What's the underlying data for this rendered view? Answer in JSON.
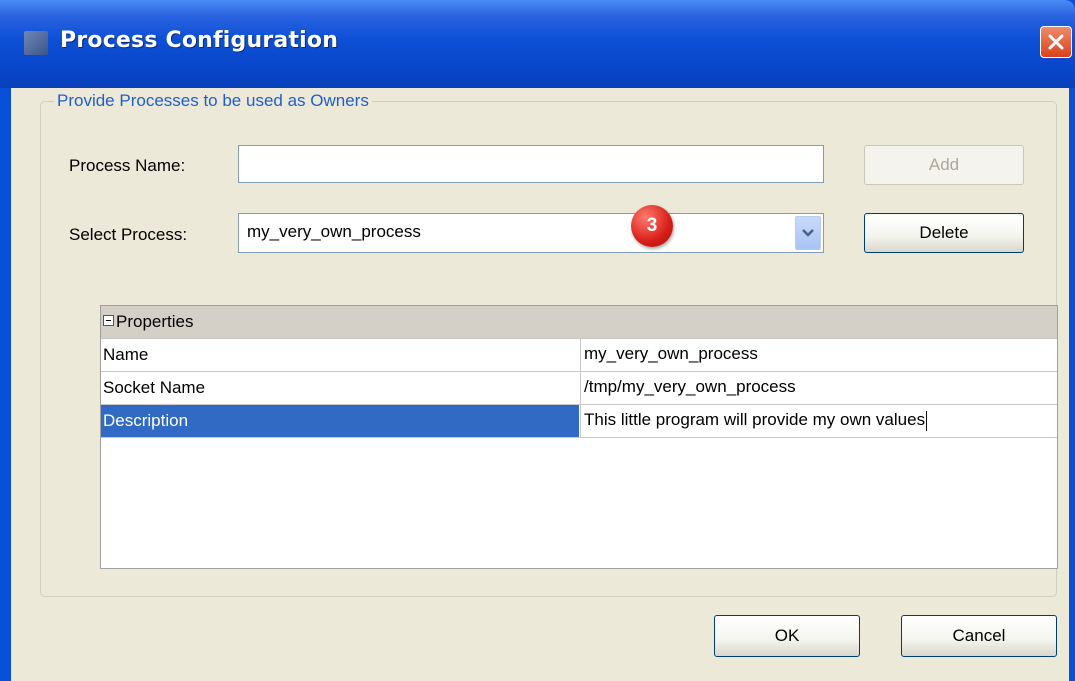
{
  "window": {
    "title": "Process Configuration"
  },
  "group": {
    "legend": "Provide Processes to be used as Owners"
  },
  "form": {
    "process_name_label": "Process Name:",
    "process_name_value": "",
    "add_label": "Add",
    "select_process_label": "Select Process:",
    "select_process_value": "my_very_own_process",
    "delete_label": "Delete"
  },
  "callout": {
    "number": "3",
    "color": "#d71e18"
  },
  "properties": {
    "header": "Properties",
    "rows": [
      {
        "name": "Name",
        "value": "my_very_own_process",
        "selected": false
      },
      {
        "name": "Socket Name",
        "value": "/tmp/my_very_own_process",
        "selected": false
      },
      {
        "name": "Description",
        "value": "This little program will provide my own values",
        "selected": true
      }
    ]
  },
  "buttons": {
    "ok_label": "OK",
    "cancel_label": "Cancel"
  },
  "icons": {
    "close": "close-icon",
    "dropdown": "chevron-down-icon",
    "collapse": "minus-box-icon",
    "app": "app-icon"
  },
  "colors": {
    "titlebar": "#0846c9",
    "selection": "#316ac5",
    "dialog_bg": "#ece9d8",
    "legend_text": "#1f5fcc"
  }
}
